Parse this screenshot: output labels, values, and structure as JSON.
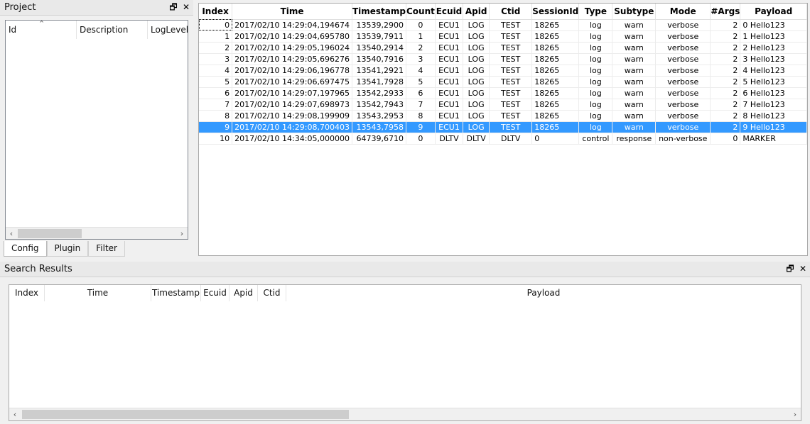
{
  "project": {
    "title": "Project",
    "columns": [
      "Id",
      "Description",
      "LogLevel"
    ],
    "tabs": [
      "Config",
      "Plugin",
      "Filter"
    ],
    "active_tab": "Config"
  },
  "dock_buttons": {
    "float": "🗗",
    "close": "✕"
  },
  "scroll_arrows": {
    "left": "‹",
    "right": "›"
  },
  "table": {
    "headers": [
      "Index",
      "Time",
      "Timestamp",
      "Count",
      "Ecuid",
      "Apid",
      "Ctid",
      "SessionId",
      "Type",
      "Subtype",
      "Mode",
      "#Args",
      "Payload"
    ],
    "rows": [
      [
        "0",
        "2017/02/10 14:29:04,194674",
        "13539,2900",
        "0",
        "ECU1",
        "LOG",
        "TEST",
        "18265",
        "log",
        "warn",
        "verbose",
        "2",
        "0 Hello123"
      ],
      [
        "1",
        "2017/02/10 14:29:04,695780",
        "13539,7911",
        "1",
        "ECU1",
        "LOG",
        "TEST",
        "18265",
        "log",
        "warn",
        "verbose",
        "2",
        "1 Hello123"
      ],
      [
        "2",
        "2017/02/10 14:29:05,196024",
        "13540,2914",
        "2",
        "ECU1",
        "LOG",
        "TEST",
        "18265",
        "log",
        "warn",
        "verbose",
        "2",
        "2 Hello123"
      ],
      [
        "3",
        "2017/02/10 14:29:05,696276",
        "13540,7916",
        "3",
        "ECU1",
        "LOG",
        "TEST",
        "18265",
        "log",
        "warn",
        "verbose",
        "2",
        "3 Hello123"
      ],
      [
        "4",
        "2017/02/10 14:29:06,196778",
        "13541,2921",
        "4",
        "ECU1",
        "LOG",
        "TEST",
        "18265",
        "log",
        "warn",
        "verbose",
        "2",
        "4 Hello123"
      ],
      [
        "5",
        "2017/02/10 14:29:06,697475",
        "13541,7928",
        "5",
        "ECU1",
        "LOG",
        "TEST",
        "18265",
        "log",
        "warn",
        "verbose",
        "2",
        "5 Hello123"
      ],
      [
        "6",
        "2017/02/10 14:29:07,197965",
        "13542,2933",
        "6",
        "ECU1",
        "LOG",
        "TEST",
        "18265",
        "log",
        "warn",
        "verbose",
        "2",
        "6 Hello123"
      ],
      [
        "7",
        "2017/02/10 14:29:07,698973",
        "13542,7943",
        "7",
        "ECU1",
        "LOG",
        "TEST",
        "18265",
        "log",
        "warn",
        "verbose",
        "2",
        "7 Hello123"
      ],
      [
        "8",
        "2017/02/10 14:29:08,199909",
        "13543,2953",
        "8",
        "ECU1",
        "LOG",
        "TEST",
        "18265",
        "log",
        "warn",
        "verbose",
        "2",
        "8 Hello123"
      ],
      [
        "9",
        "2017/02/10 14:29:08,700403",
        "13543,7958",
        "9",
        "ECU1",
        "LOG",
        "TEST",
        "18265",
        "log",
        "warn",
        "verbose",
        "2",
        "9 Hello123"
      ],
      [
        "10",
        "2017/02/10 14:34:05,000000",
        "64739,6710",
        "0",
        "DLTV",
        "DLTV",
        "DLTV",
        "0",
        "control",
        "response",
        "non-verbose",
        "0",
        "MARKER"
      ]
    ],
    "selected_row": 9,
    "current_row": 0,
    "selection_color": "#3399ff"
  },
  "search": {
    "title": "Search Results",
    "columns": [
      "Index",
      "Time",
      "Timestamp",
      "Ecuid",
      "Apid",
      "Ctid",
      "Payload"
    ]
  }
}
